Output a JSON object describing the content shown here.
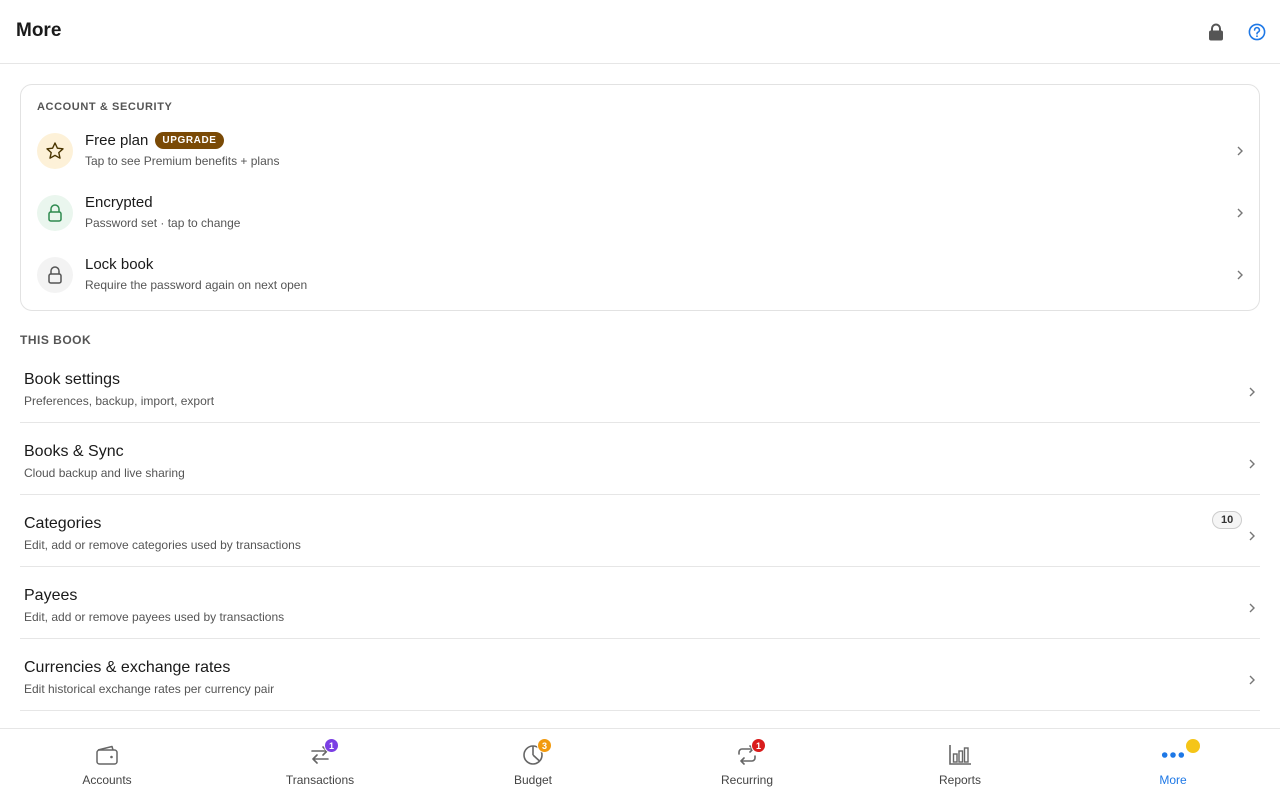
{
  "header": {
    "title": "More",
    "lock_icon": "lock-icon",
    "help_icon": "help-circle-icon"
  },
  "account_security": {
    "heading": "ACCOUNT & SECURITY",
    "items": [
      {
        "title": "Free plan",
        "badge": "UPGRADE",
        "subtitle": "Tap to see Premium benefits + plans",
        "icon": "star-icon",
        "icon_bg": "#fdf1d8",
        "icon_color": "#4a3500"
      },
      {
        "title": "Encrypted",
        "subtitle": "Password set · tap to change",
        "icon": "lock-icon",
        "icon_bg": "#eaf6ee",
        "icon_color": "#2e8a4f"
      },
      {
        "title": "Lock book",
        "subtitle": "Require the password again on next open",
        "icon": "lock-icon",
        "icon_bg": "#f3f3f3",
        "icon_color": "#555555"
      }
    ]
  },
  "this_book": {
    "heading": "THIS BOOK",
    "items": [
      {
        "title": "Book settings",
        "subtitle": "Preferences, backup, import, export"
      },
      {
        "title": "Books & Sync",
        "subtitle": "Cloud backup and live sharing"
      },
      {
        "title": "Categories",
        "subtitle": "Edit, add or remove categories used by transactions",
        "count": "10"
      },
      {
        "title": "Payees",
        "subtitle": "Edit, add or remove payees used by transactions"
      },
      {
        "title": "Currencies & exchange rates",
        "subtitle": "Edit historical exchange rates per currency pair"
      }
    ]
  },
  "bottom_nav": {
    "items": [
      {
        "label": "Accounts",
        "icon": "wallet-icon"
      },
      {
        "label": "Transactions",
        "icon": "transfer-arrows-icon",
        "badge": "1",
        "badge_color": "#7b3fe4"
      },
      {
        "label": "Budget",
        "icon": "pie-chart-icon",
        "badge": "3",
        "badge_color": "#f29a0e"
      },
      {
        "label": "Recurring",
        "icon": "repeat-icon",
        "badge": "1",
        "badge_color": "#d91c1c"
      },
      {
        "label": "Reports",
        "icon": "bar-chart-icon"
      },
      {
        "label": "More",
        "icon": "more-dots-icon",
        "active": true,
        "dot_color": "#f5c518",
        "accent": "#1e78e6"
      }
    ]
  }
}
